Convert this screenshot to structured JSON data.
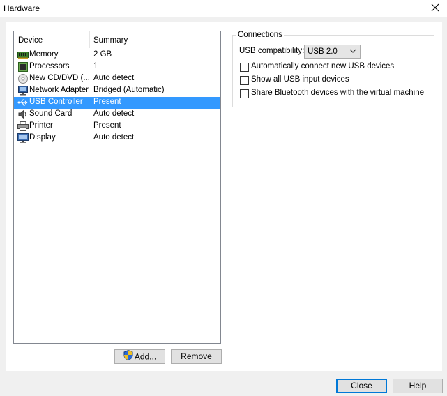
{
  "window": {
    "title": "Hardware",
    "close_glyph": "✕"
  },
  "device_list": {
    "columns": [
      "Device",
      "Summary"
    ],
    "rows": [
      {
        "device": "Memory",
        "summary": "2 GB",
        "icon": "memory-icon",
        "selected": false
      },
      {
        "device": "Processors",
        "summary": "1",
        "icon": "processor-icon",
        "selected": false
      },
      {
        "device": "New CD/DVD (...",
        "summary": "Auto detect",
        "icon": "cd-dvd-icon",
        "selected": false
      },
      {
        "device": "Network Adapter",
        "summary": "Bridged (Automatic)",
        "icon": "network-adapter-icon",
        "selected": false
      },
      {
        "device": "USB Controller",
        "summary": "Present",
        "icon": "usb-icon",
        "selected": true
      },
      {
        "device": "Sound Card",
        "summary": "Auto detect",
        "icon": "sound-card-icon",
        "selected": false
      },
      {
        "device": "Printer",
        "summary": "Present",
        "icon": "printer-icon",
        "selected": false
      },
      {
        "device": "Display",
        "summary": "Auto detect",
        "icon": "display-icon",
        "selected": false
      }
    ]
  },
  "list_buttons": {
    "add_label": "Add...",
    "remove_label": "Remove"
  },
  "connections": {
    "group_label": "Connections",
    "usb_compat_label": "USB compatibility:",
    "usb_compat_value": "USB 2.0",
    "checkboxes": [
      {
        "label": "Automatically connect new USB devices",
        "checked": false
      },
      {
        "label": "Show all USB input devices",
        "checked": false
      },
      {
        "label": "Share Bluetooth devices with the virtual machine",
        "checked": false
      }
    ]
  },
  "footer": {
    "close_label": "Close",
    "help_label": "Help"
  },
  "colors": {
    "selection": "#3399ff",
    "default_button_border": "#0078d7"
  }
}
